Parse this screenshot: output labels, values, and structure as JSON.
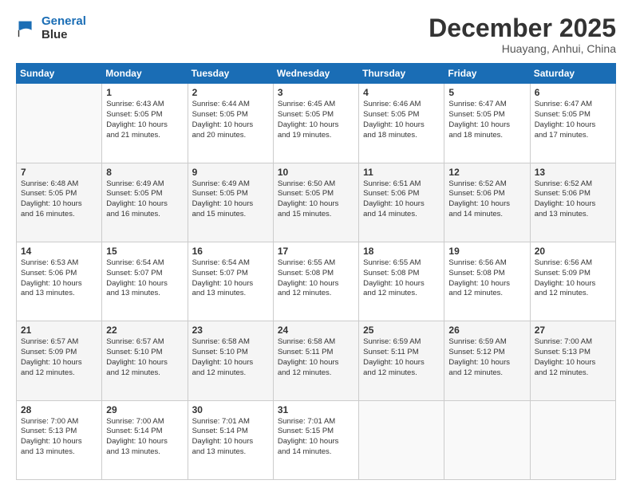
{
  "logo": {
    "line1": "General",
    "line2": "Blue"
  },
  "title": "December 2025",
  "location": "Huayang, Anhui, China",
  "weekdays": [
    "Sunday",
    "Monday",
    "Tuesday",
    "Wednesday",
    "Thursday",
    "Friday",
    "Saturday"
  ],
  "weeks": [
    [
      {
        "day": "",
        "info": ""
      },
      {
        "day": "1",
        "info": "Sunrise: 6:43 AM\nSunset: 5:05 PM\nDaylight: 10 hours\nand 21 minutes."
      },
      {
        "day": "2",
        "info": "Sunrise: 6:44 AM\nSunset: 5:05 PM\nDaylight: 10 hours\nand 20 minutes."
      },
      {
        "day": "3",
        "info": "Sunrise: 6:45 AM\nSunset: 5:05 PM\nDaylight: 10 hours\nand 19 minutes."
      },
      {
        "day": "4",
        "info": "Sunrise: 6:46 AM\nSunset: 5:05 PM\nDaylight: 10 hours\nand 18 minutes."
      },
      {
        "day": "5",
        "info": "Sunrise: 6:47 AM\nSunset: 5:05 PM\nDaylight: 10 hours\nand 18 minutes."
      },
      {
        "day": "6",
        "info": "Sunrise: 6:47 AM\nSunset: 5:05 PM\nDaylight: 10 hours\nand 17 minutes."
      }
    ],
    [
      {
        "day": "7",
        "info": "Sunrise: 6:48 AM\nSunset: 5:05 PM\nDaylight: 10 hours\nand 16 minutes."
      },
      {
        "day": "8",
        "info": "Sunrise: 6:49 AM\nSunset: 5:05 PM\nDaylight: 10 hours\nand 16 minutes."
      },
      {
        "day": "9",
        "info": "Sunrise: 6:49 AM\nSunset: 5:05 PM\nDaylight: 10 hours\nand 15 minutes."
      },
      {
        "day": "10",
        "info": "Sunrise: 6:50 AM\nSunset: 5:05 PM\nDaylight: 10 hours\nand 15 minutes."
      },
      {
        "day": "11",
        "info": "Sunrise: 6:51 AM\nSunset: 5:06 PM\nDaylight: 10 hours\nand 14 minutes."
      },
      {
        "day": "12",
        "info": "Sunrise: 6:52 AM\nSunset: 5:06 PM\nDaylight: 10 hours\nand 14 minutes."
      },
      {
        "day": "13",
        "info": "Sunrise: 6:52 AM\nSunset: 5:06 PM\nDaylight: 10 hours\nand 13 minutes."
      }
    ],
    [
      {
        "day": "14",
        "info": "Sunrise: 6:53 AM\nSunset: 5:06 PM\nDaylight: 10 hours\nand 13 minutes."
      },
      {
        "day": "15",
        "info": "Sunrise: 6:54 AM\nSunset: 5:07 PM\nDaylight: 10 hours\nand 13 minutes."
      },
      {
        "day": "16",
        "info": "Sunrise: 6:54 AM\nSunset: 5:07 PM\nDaylight: 10 hours\nand 13 minutes."
      },
      {
        "day": "17",
        "info": "Sunrise: 6:55 AM\nSunset: 5:08 PM\nDaylight: 10 hours\nand 12 minutes."
      },
      {
        "day": "18",
        "info": "Sunrise: 6:55 AM\nSunset: 5:08 PM\nDaylight: 10 hours\nand 12 minutes."
      },
      {
        "day": "19",
        "info": "Sunrise: 6:56 AM\nSunset: 5:08 PM\nDaylight: 10 hours\nand 12 minutes."
      },
      {
        "day": "20",
        "info": "Sunrise: 6:56 AM\nSunset: 5:09 PM\nDaylight: 10 hours\nand 12 minutes."
      }
    ],
    [
      {
        "day": "21",
        "info": "Sunrise: 6:57 AM\nSunset: 5:09 PM\nDaylight: 10 hours\nand 12 minutes."
      },
      {
        "day": "22",
        "info": "Sunrise: 6:57 AM\nSunset: 5:10 PM\nDaylight: 10 hours\nand 12 minutes."
      },
      {
        "day": "23",
        "info": "Sunrise: 6:58 AM\nSunset: 5:10 PM\nDaylight: 10 hours\nand 12 minutes."
      },
      {
        "day": "24",
        "info": "Sunrise: 6:58 AM\nSunset: 5:11 PM\nDaylight: 10 hours\nand 12 minutes."
      },
      {
        "day": "25",
        "info": "Sunrise: 6:59 AM\nSunset: 5:11 PM\nDaylight: 10 hours\nand 12 minutes."
      },
      {
        "day": "26",
        "info": "Sunrise: 6:59 AM\nSunset: 5:12 PM\nDaylight: 10 hours\nand 12 minutes."
      },
      {
        "day": "27",
        "info": "Sunrise: 7:00 AM\nSunset: 5:13 PM\nDaylight: 10 hours\nand 12 minutes."
      }
    ],
    [
      {
        "day": "28",
        "info": "Sunrise: 7:00 AM\nSunset: 5:13 PM\nDaylight: 10 hours\nand 13 minutes."
      },
      {
        "day": "29",
        "info": "Sunrise: 7:00 AM\nSunset: 5:14 PM\nDaylight: 10 hours\nand 13 minutes."
      },
      {
        "day": "30",
        "info": "Sunrise: 7:01 AM\nSunset: 5:14 PM\nDaylight: 10 hours\nand 13 minutes."
      },
      {
        "day": "31",
        "info": "Sunrise: 7:01 AM\nSunset: 5:15 PM\nDaylight: 10 hours\nand 14 minutes."
      },
      {
        "day": "",
        "info": ""
      },
      {
        "day": "",
        "info": ""
      },
      {
        "day": "",
        "info": ""
      }
    ]
  ]
}
